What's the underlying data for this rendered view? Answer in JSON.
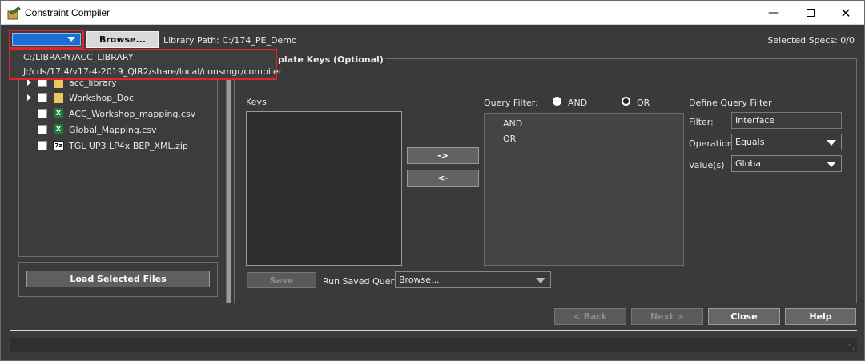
{
  "window": {
    "title": "Constraint Compiler"
  },
  "toolbar": {
    "browse_label": "Browse...",
    "library_path": "Library Path: C:/174_PE_Demo",
    "selected_specs": "Selected Specs: 0/0"
  },
  "dropdown": {
    "options": [
      "C:/LIBRARY/ACC_LIBRARY",
      "J:/cds/17.4/v17-4-2019_QIR2/share/local/consmgr/compiler"
    ]
  },
  "file_tree": {
    "items": [
      {
        "label": "acc_library",
        "type": "folder"
      },
      {
        "label": "Workshop_Doc",
        "type": "folder"
      },
      {
        "label": "ACC_Workshop_mapping.csv",
        "type": "excel"
      },
      {
        "label": "Global_Mapping.csv",
        "type": "excel"
      },
      {
        "label": "TGL UP3 LP4x BEP_XML.zip",
        "type": "zip"
      }
    ],
    "load_button": "Load Selected Files"
  },
  "template": {
    "section_title": "plate Keys (Optional)",
    "keys_label": "Keys:",
    "add_arrow": "->",
    "remove_arrow": "<-",
    "query_filter_label": "Query Filter:",
    "and_label": "AND",
    "or_label": "OR",
    "query_items": [
      "AND",
      "OR"
    ],
    "define_label": "Define Query Filter",
    "filter_label": "Filter:",
    "filter_value": "Interface",
    "operation_label": "Operation",
    "operation_value": "Equals",
    "values_label": "Value(s)",
    "values_value": "Global",
    "save_label": "Save",
    "run_saved_label": "Run Saved Query:",
    "run_saved_value": "Browse..."
  },
  "footer": {
    "back": "< Back",
    "next": "Next >",
    "close": "Close",
    "help": "Help"
  },
  "colors": {
    "highlight_red": "#e0262b",
    "select_blue": "#1a6fd6"
  }
}
